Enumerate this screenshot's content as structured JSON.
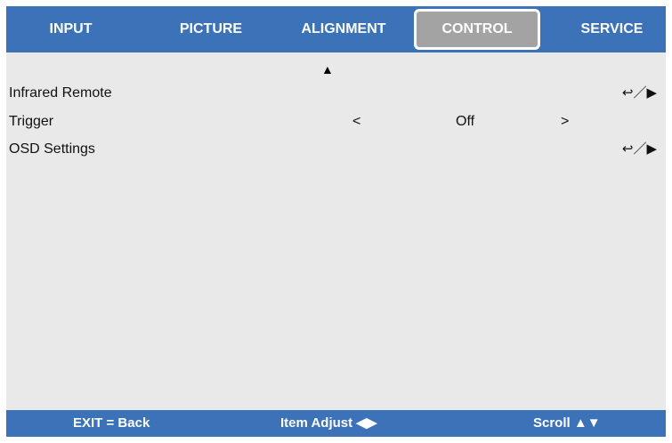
{
  "tabs": [
    {
      "label": "INPUT"
    },
    {
      "label": "PICTURE"
    },
    {
      "label": "ALIGNMENT"
    },
    {
      "label": "CONTROL",
      "selected": true
    },
    {
      "label": "SERVICE"
    }
  ],
  "scroll_indicator": "▲",
  "menu": {
    "items": [
      {
        "label": "Infrared Remote",
        "action": "↩／▶"
      },
      {
        "label": "Trigger",
        "left_arrow": "<",
        "value": "Off",
        "right_arrow": ">"
      },
      {
        "label": "OSD Settings",
        "action": "↩／▶"
      }
    ]
  },
  "footer": {
    "exit": "EXIT = Back",
    "adjust": "Item Adjust ◀▶",
    "scroll": "Scroll ▲▼"
  },
  "colors": {
    "header_bg": "#3c72b8",
    "selected_tab_bg": "#a3a3a3",
    "panel_bg": "#e8e9e8"
  }
}
